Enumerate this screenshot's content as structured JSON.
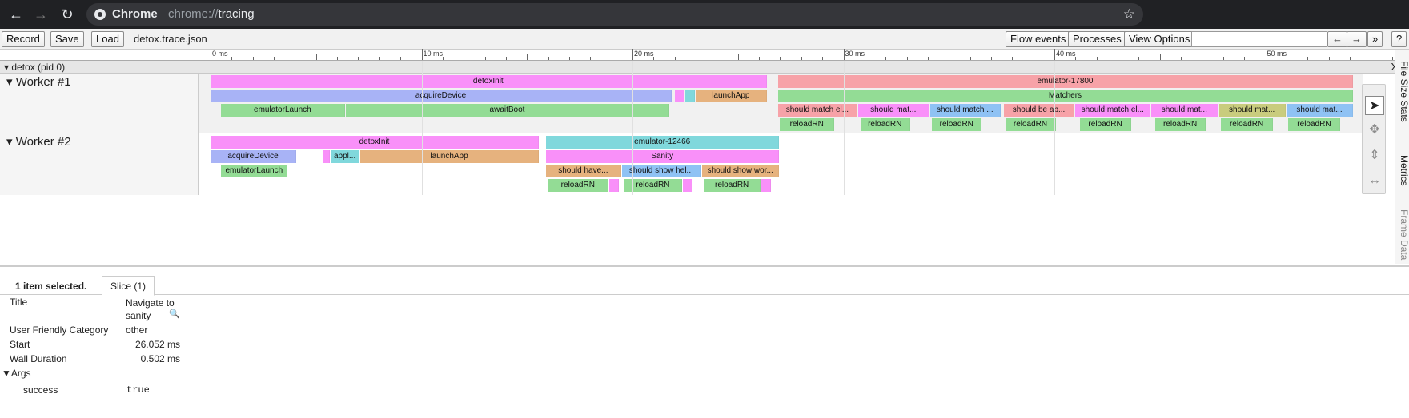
{
  "browser": {
    "tab_chip": "Chrome",
    "url_prefix": "chrome://",
    "url_page": "tracing"
  },
  "toolbar": {
    "record": "Record",
    "save": "Save",
    "load": "Load",
    "filename": "detox.trace.json",
    "flow_events": "Flow events",
    "processes": "Processes",
    "view_options": "View Options",
    "nav_left": "←",
    "nav_right": "→",
    "more": "»",
    "help": "?",
    "search_placeholder": ""
  },
  "ruler": {
    "labels": [
      "0 ms",
      "10 ms",
      "20 ms",
      "30 ms",
      "40 ms",
      "50 ms"
    ]
  },
  "process": {
    "title": "detox (pid 0)",
    "close": "X"
  },
  "workers": [
    {
      "label": "Worker #1",
      "slices": [
        {
          "text": "detoxInit",
          "start_ms": 0,
          "end_ms": 26.4,
          "depth": 0,
          "color": "#f990f9"
        },
        {
          "text": "emulator-17800",
          "start_ms": 26.9,
          "end_ms": 54.2,
          "depth": 0,
          "color": "#f7a2a8"
        },
        {
          "text": "acquireDevice",
          "start_ms": 0,
          "end_ms": 21.9,
          "depth": 1,
          "color": "#a8b3f6"
        },
        {
          "text": "",
          "start_ms": 22.0,
          "end_ms": 22.5,
          "depth": 1,
          "color": "#f990f9"
        },
        {
          "text": "",
          "start_ms": 22.5,
          "end_ms": 23.0,
          "depth": 1,
          "color": "#80d8dc"
        },
        {
          "text": "launchApp",
          "start_ms": 23.0,
          "end_ms": 26.4,
          "depth": 1,
          "color": "#e6b27e"
        },
        {
          "text": "Matchers",
          "start_ms": 26.9,
          "end_ms": 54.2,
          "depth": 1,
          "color": "#93dc95"
        },
        {
          "text": "emulatorLaunch",
          "start_ms": 0.5,
          "end_ms": 6.4,
          "depth": 2,
          "color": "#93dc95"
        },
        {
          "text": "awaitBoot",
          "start_ms": 6.4,
          "end_ms": 21.8,
          "depth": 2,
          "color": "#93dc95"
        },
        {
          "text": "should match el...",
          "start_ms": 26.9,
          "end_ms": 30.7,
          "depth": 2,
          "color": "#f7a2a8"
        },
        {
          "text": "should mat...",
          "start_ms": 30.7,
          "end_ms": 34.1,
          "depth": 2,
          "color": "#f990f9"
        },
        {
          "text": "should match ...",
          "start_ms": 34.1,
          "end_ms": 37.5,
          "depth": 2,
          "color": "#8fc2f4"
        },
        {
          "text": "should be ab...",
          "start_ms": 37.6,
          "end_ms": 41.0,
          "depth": 2,
          "color": "#f7a2a8"
        },
        {
          "text": "should match el...",
          "start_ms": 41.0,
          "end_ms": 44.6,
          "depth": 2,
          "color": "#f990f9"
        },
        {
          "text": "should mat...",
          "start_ms": 44.6,
          "end_ms": 47.8,
          "depth": 2,
          "color": "#f990f9"
        },
        {
          "text": "should mat...",
          "start_ms": 47.8,
          "end_ms": 51.0,
          "depth": 2,
          "color": "#c9cc7e"
        },
        {
          "text": "should mat...",
          "start_ms": 51.0,
          "end_ms": 54.2,
          "depth": 2,
          "color": "#8fc2f4"
        },
        {
          "text": "reloadRN",
          "start_ms": 27.0,
          "end_ms": 29.6,
          "depth": 3,
          "color": "#93dc95"
        },
        {
          "text": "reloadRN",
          "start_ms": 30.8,
          "end_ms": 33.2,
          "depth": 3,
          "color": "#93dc95"
        },
        {
          "text": "reloadRN",
          "start_ms": 34.2,
          "end_ms": 36.6,
          "depth": 3,
          "color": "#93dc95"
        },
        {
          "text": "reloadRN",
          "start_ms": 37.7,
          "end_ms": 40.1,
          "depth": 3,
          "color": "#93dc95"
        },
        {
          "text": "reloadRN",
          "start_ms": 41.2,
          "end_ms": 43.7,
          "depth": 3,
          "color": "#93dc95"
        },
        {
          "text": "reloadRN",
          "start_ms": 44.8,
          "end_ms": 47.2,
          "depth": 3,
          "color": "#93dc95"
        },
        {
          "text": "reloadRN",
          "start_ms": 47.9,
          "end_ms": 50.4,
          "depth": 3,
          "color": "#93dc95"
        },
        {
          "text": "reloadRN",
          "start_ms": 51.1,
          "end_ms": 53.6,
          "depth": 3,
          "color": "#93dc95"
        }
      ]
    },
    {
      "label": "Worker #2",
      "slices": [
        {
          "text": "detoxInit",
          "start_ms": 0,
          "end_ms": 15.6,
          "depth": 0,
          "color": "#f990f9"
        },
        {
          "text": "emulator-12466",
          "start_ms": 15.9,
          "end_ms": 27.0,
          "depth": 0,
          "color": "#80d8dc"
        },
        {
          "text": "acquireDevice",
          "start_ms": 0,
          "end_ms": 4.1,
          "depth": 1,
          "color": "#a8b3f6"
        },
        {
          "text": "",
          "start_ms": 5.3,
          "end_ms": 5.7,
          "depth": 1,
          "color": "#f990f9"
        },
        {
          "text": "appl...",
          "start_ms": 5.7,
          "end_ms": 7.1,
          "depth": 1,
          "color": "#80d8dc"
        },
        {
          "text": "launchApp",
          "start_ms": 7.1,
          "end_ms": 15.6,
          "depth": 1,
          "color": "#e6b27e"
        },
        {
          "text": "Sanity",
          "start_ms": 15.9,
          "end_ms": 27.0,
          "depth": 1,
          "color": "#f990f9"
        },
        {
          "text": "emulatorLaunch",
          "start_ms": 0.5,
          "end_ms": 3.7,
          "depth": 2,
          "color": "#93dc95"
        },
        {
          "text": "should have...",
          "start_ms": 15.9,
          "end_ms": 19.5,
          "depth": 2,
          "color": "#e6b27e"
        },
        {
          "text": "should show hel...",
          "start_ms": 19.5,
          "end_ms": 23.3,
          "depth": 2,
          "color": "#8fc2f4"
        },
        {
          "text": "should show wor...",
          "start_ms": 23.3,
          "end_ms": 27.0,
          "depth": 2,
          "color": "#e6b27e"
        },
        {
          "text": "reloadRN",
          "start_ms": 16.0,
          "end_ms": 18.9,
          "depth": 3,
          "color": "#93dc95"
        },
        {
          "text": "",
          "start_ms": 18.9,
          "end_ms": 19.4,
          "depth": 3,
          "color": "#f990f9"
        },
        {
          "text": "reloadRN",
          "start_ms": 19.6,
          "end_ms": 22.4,
          "depth": 3,
          "color": "#93dc95"
        },
        {
          "text": "",
          "start_ms": 22.4,
          "end_ms": 22.9,
          "depth": 3,
          "color": "#f990f9"
        },
        {
          "text": "reloadRN",
          "start_ms": 23.4,
          "end_ms": 26.1,
          "depth": 3,
          "color": "#93dc95"
        },
        {
          "text": "",
          "start_ms": 26.1,
          "end_ms": 26.6,
          "depth": 3,
          "color": "#f990f9"
        }
      ]
    }
  ],
  "side_tabs": [
    "File Size Stats",
    "Metrics",
    "Frame Data"
  ],
  "analysis": {
    "selected": "1 item selected.",
    "tab": "Slice (1)",
    "rows": [
      {
        "label": "Title",
        "value": "Navigate to\nsanity"
      },
      {
        "label": "User Friendly Category",
        "value": "other"
      },
      {
        "label": "Start",
        "value": "26.052 ms"
      },
      {
        "label": "Wall Duration",
        "value": "0.502 ms"
      }
    ],
    "args_label": "▼Args",
    "arg": {
      "key": "success",
      "value": "true"
    }
  },
  "icons": [
    "back-icon",
    "forward-icon",
    "reload-icon",
    "star-icon",
    "select-tool-icon",
    "pan-tool-icon",
    "zoom-tool-icon",
    "timing-tool-icon",
    "magnifier-icon"
  ]
}
